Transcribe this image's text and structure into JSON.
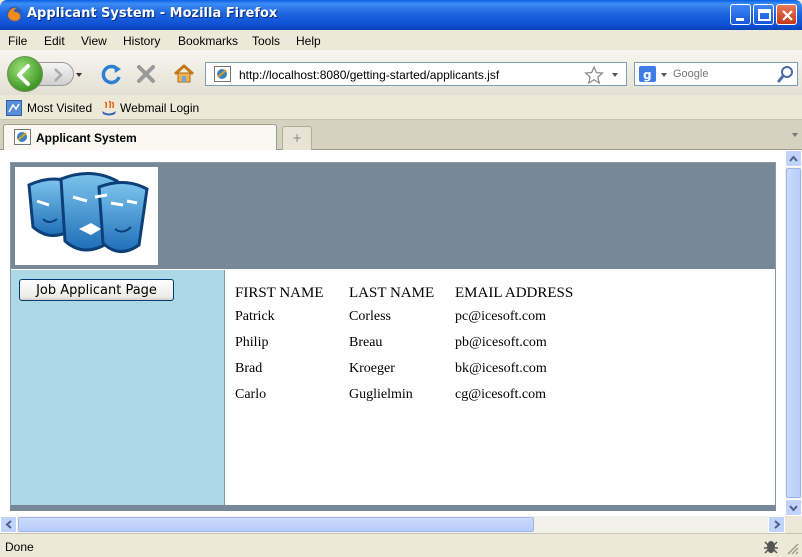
{
  "window": {
    "title": "Applicant System - Mozilla Firefox"
  },
  "menu": {
    "items": [
      "File",
      "Edit",
      "View",
      "History",
      "Bookmarks",
      "Tools",
      "Help"
    ]
  },
  "nav": {
    "url": "http://localhost:8080/getting-started/applicants.jsf",
    "search_placeholder": "Google"
  },
  "bookmarks": {
    "items": [
      "Most Visited",
      "Webmail Login"
    ]
  },
  "tabs": {
    "active_label": "Applicant System"
  },
  "page": {
    "job_button_label": "Job Applicant Page",
    "columns": [
      "FIRST NAME",
      "LAST NAME",
      "EMAIL ADDRESS"
    ],
    "rows": [
      [
        "Patrick",
        "Corless",
        "pc@icesoft.com"
      ],
      [
        "Philip",
        "Breau",
        "pb@icesoft.com"
      ],
      [
        "Brad",
        "Kroeger",
        "bk@icesoft.com"
      ],
      [
        "Carlo",
        "Guglielmin",
        "cg@icesoft.com"
      ]
    ],
    "colors": {
      "header_band": "#778899",
      "sidebar": "#add8e6"
    }
  },
  "status": {
    "text": "Done"
  }
}
